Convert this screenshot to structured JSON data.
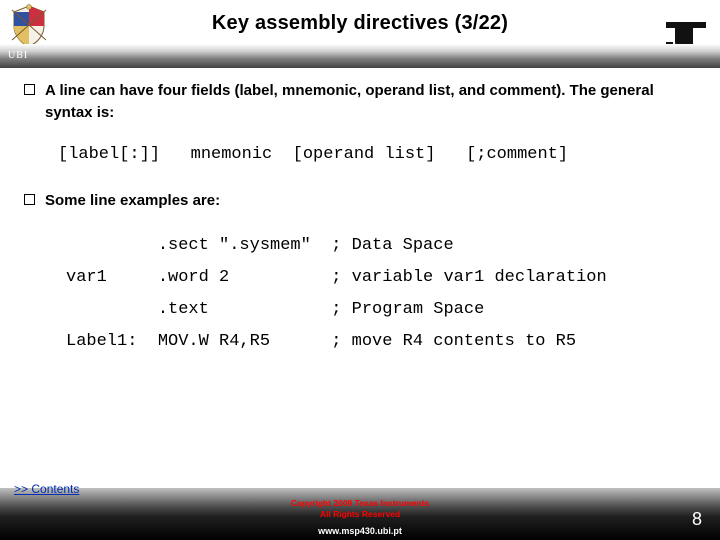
{
  "header": {
    "title": "Key assembly directives (3/22)",
    "ubi": "UBI"
  },
  "body": {
    "bullet1": "A line can have four fields (label, mnemonic, operand list, and comment). The general syntax is:",
    "syntax": "[label[:]]   mnemonic  [operand list]   [;comment]",
    "bullet2": "Some line examples are:",
    "examples": "         .sect \".sysmem\"  ; Data Space\nvar1     .word 2          ; variable var1 declaration\n         .text            ; Program Space\nLabel1:  MOV.W R4,R5      ; move R4 contents to R5"
  },
  "footer": {
    "contents": ">> Contents",
    "copyright_line1": "Copyright 2009 Texas Instruments",
    "copyright_line2": "All Rights Reserved",
    "url": "www.msp430.ubi.pt",
    "page": "8"
  }
}
